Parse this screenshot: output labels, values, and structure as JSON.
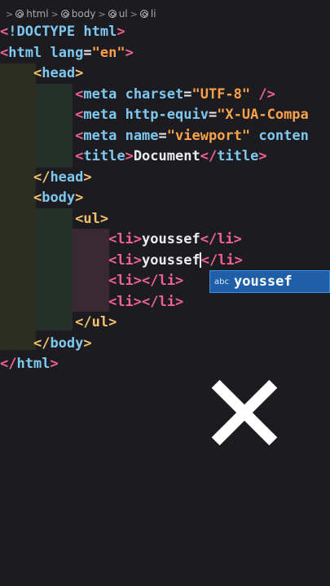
{
  "breadcrumb": {
    "items": [
      "html",
      "body",
      "ul",
      "li"
    ],
    "separator": ">"
  },
  "code": {
    "doctype": "!DOCTYPE html",
    "html_open_tag": "html",
    "html_attr": "lang",
    "html_attr_value": "\"en\"",
    "head_tag": "head",
    "meta1_attr": "charset",
    "meta1_value": "\"UTF-8\"",
    "meta1_close": "/",
    "meta2_attr": "http-equiv",
    "meta2_value": "\"X-UA-Compa",
    "meta3_attr": "name",
    "meta3_value": "\"viewport\"",
    "meta3_rest": "conten",
    "meta_tag": "meta",
    "title_tag": "title",
    "title_text": "Document",
    "body_tag": "body",
    "ul_tag": "ul",
    "li_tag": "li",
    "li1_text": "youssef",
    "li2_text": "youssef"
  },
  "autocomplete": {
    "icon_text": "abc",
    "suggestion": "youssef"
  },
  "colors": {
    "background": "#1c1c20",
    "tag": "#7ec8f0",
    "bracket": "#f06292",
    "string": "#f9a24b",
    "suggest_bg": "#1e5fa8"
  }
}
